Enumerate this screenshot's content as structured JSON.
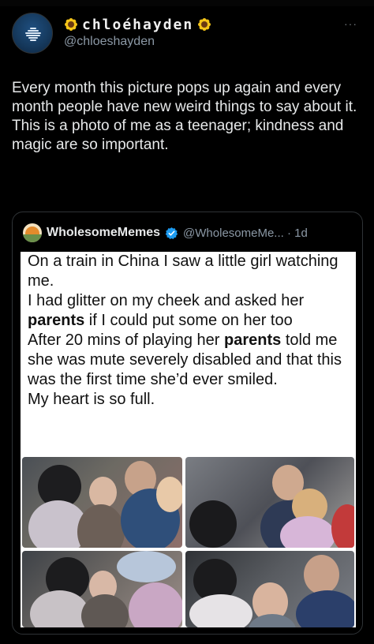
{
  "author": {
    "display_name": "chloéhayden",
    "handle": "@chloeshayden",
    "more_label": "···"
  },
  "tweet": {
    "text_lines": [
      "Every month this picture pops up again and every month people have new weird things to say about it.",
      "This is a photo of me as a teenager; kindness and magic are so important."
    ]
  },
  "quoted": {
    "display_name": "WholesomeMemes",
    "handle_time": "@WholesomeMe... · 1d",
    "meme_lines": [
      {
        "pre": "On a train in China I saw a little girl watching me.",
        "bold": "",
        "post": ""
      },
      {
        "pre": "I had glitter on my cheek and asked her ",
        "bold": "parents",
        "post": " if I could put some on her too"
      },
      {
        "pre": "After 20 mins of playing her ",
        "bold": "parents",
        "post": " told me she was mute severely disabled and that this was the first time she’d ever smiled."
      },
      {
        "pre": "My heart is so full.",
        "bold": "",
        "post": ""
      }
    ]
  },
  "colors": {
    "background": "#000000",
    "text": "#e7e9ea",
    "secondary_text": "#8b98a5",
    "verified": "#1d9bf0",
    "border": "#2f3336"
  },
  "icons": [
    "sunflower-icon",
    "verified-badge-icon",
    "more-icon"
  ]
}
